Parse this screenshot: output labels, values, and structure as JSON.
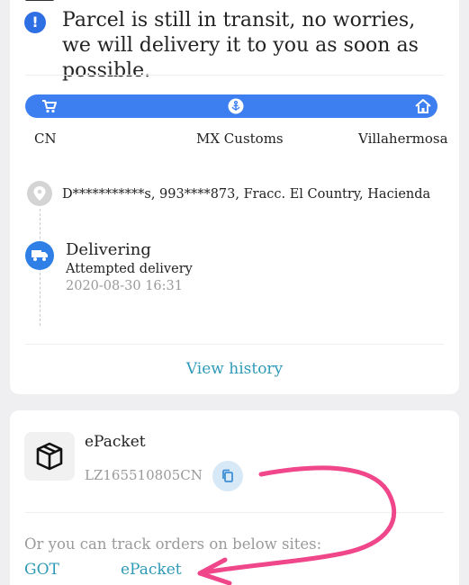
{
  "notice": {
    "text": "Parcel is still in transit, no worries, we will delivery it to you as soon as possible.",
    "icon": "info-icon"
  },
  "route": {
    "color": "#3d7ff0",
    "stops": [
      {
        "label": "CN",
        "icon": "cart-icon"
      },
      {
        "label": "MX Customs",
        "icon": "anchor-icon"
      },
      {
        "label": "Villahermosa",
        "icon": "home-icon"
      }
    ]
  },
  "address": {
    "text": "D***********s,  993****873,  Fracc. El Country, Hacienda",
    "icon": "location-pin-icon"
  },
  "event": {
    "title": "Delivering",
    "subtitle": "Attempted delivery",
    "time": "2020-08-30 16:31",
    "icon": "truck-icon"
  },
  "view_history_label": "View history",
  "package": {
    "carrier": "ePacket",
    "tracking_number": "LZ165510805CN",
    "icon": "package-icon",
    "copy_icon": "copy-icon"
  },
  "track_hint": "Or you can track orders on below sites:",
  "sites": [
    {
      "label": "GOT"
    },
    {
      "label": "ePacket"
    }
  ],
  "colors": {
    "accent": "#2f6fe4",
    "link": "#2e9ab8",
    "annotation": "#f0468a"
  }
}
